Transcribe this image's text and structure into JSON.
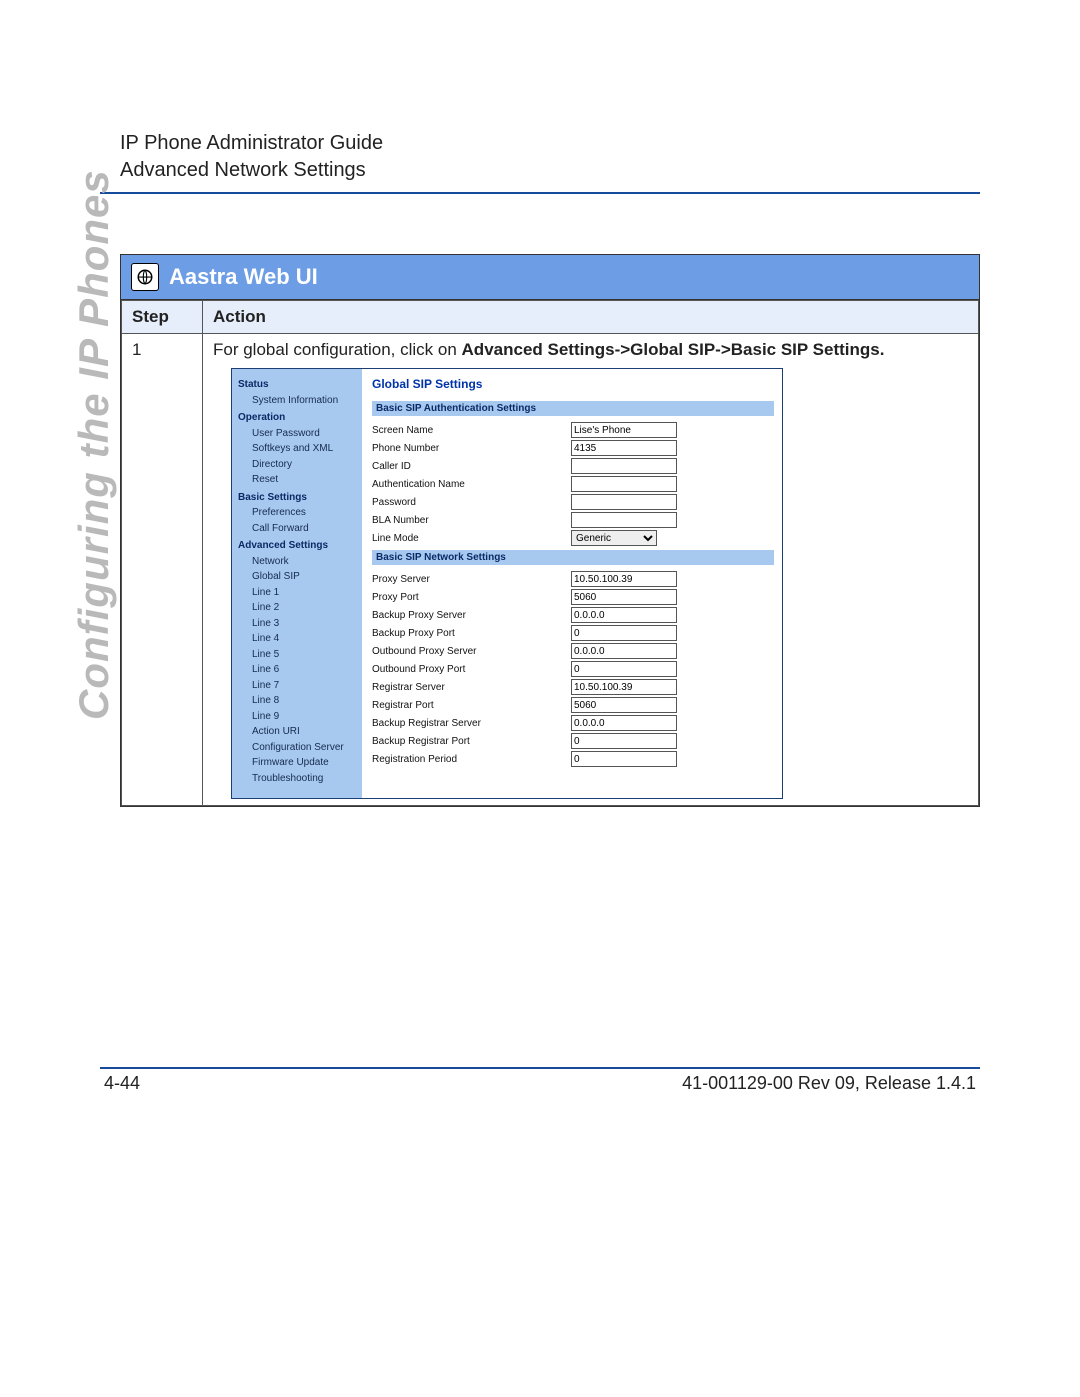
{
  "header": {
    "line1": "IP Phone Administrator Guide",
    "line2": "Advanced Network Settings"
  },
  "side_title": "Configuring the IP Phones",
  "box": {
    "title": "Aastra Web UI",
    "columns": {
      "step": "Step",
      "action": "Action"
    },
    "step_num": "1",
    "instruction_prefix": "For global configuration, click on ",
    "instruction_bold": "Advanced Settings->Global SIP->Basic SIP Settings."
  },
  "nav": {
    "status": "Status",
    "status_items": [
      "System Information"
    ],
    "operation": "Operation",
    "operation_items": [
      "User Password",
      "Softkeys and XML",
      "Directory",
      "Reset"
    ],
    "basic": "Basic Settings",
    "basic_items": [
      "Preferences",
      "Call Forward"
    ],
    "advanced": "Advanced Settings",
    "advanced_items": [
      "Network",
      "Global SIP",
      "Line 1",
      "Line 2",
      "Line 3",
      "Line 4",
      "Line 5",
      "Line 6",
      "Line 7",
      "Line 8",
      "Line 9",
      "Action URI",
      "Configuration Server",
      "Firmware Update",
      "Troubleshooting"
    ]
  },
  "panel": {
    "title": "Global SIP Settings",
    "auth_section": "Basic SIP Authentication Settings",
    "net_section": "Basic SIP Network Settings",
    "auth_fields": {
      "screen_name": {
        "label": "Screen Name",
        "value": "Lise's Phone"
      },
      "phone_number": {
        "label": "Phone Number",
        "value": "4135"
      },
      "caller_id": {
        "label": "Caller ID",
        "value": ""
      },
      "auth_name": {
        "label": "Authentication Name",
        "value": ""
      },
      "password": {
        "label": "Password",
        "value": ""
      },
      "bla_number": {
        "label": "BLA Number",
        "value": ""
      },
      "line_mode": {
        "label": "Line Mode",
        "value": "Generic"
      }
    },
    "net_fields": {
      "proxy_server": {
        "label": "Proxy Server",
        "value": "10.50.100.39"
      },
      "proxy_port": {
        "label": "Proxy Port",
        "value": "5060"
      },
      "backup_proxy_server": {
        "label": "Backup Proxy Server",
        "value": "0.0.0.0"
      },
      "backup_proxy_port": {
        "label": "Backup Proxy Port",
        "value": "0"
      },
      "outbound_proxy_server": {
        "label": "Outbound Proxy Server",
        "value": "0.0.0.0"
      },
      "outbound_proxy_port": {
        "label": "Outbound Proxy Port",
        "value": "0"
      },
      "registrar_server": {
        "label": "Registrar Server",
        "value": "10.50.100.39"
      },
      "registrar_port": {
        "label": "Registrar Port",
        "value": "5060"
      },
      "backup_registrar_server": {
        "label": "Backup Registrar Server",
        "value": "0.0.0.0"
      },
      "backup_registrar_port": {
        "label": "Backup Registrar Port",
        "value": "0"
      },
      "registration_period": {
        "label": "Registration Period",
        "value": "0"
      }
    }
  },
  "footer": {
    "left": "4-44",
    "right": "41-001129-00 Rev 09, Release 1.4.1"
  }
}
